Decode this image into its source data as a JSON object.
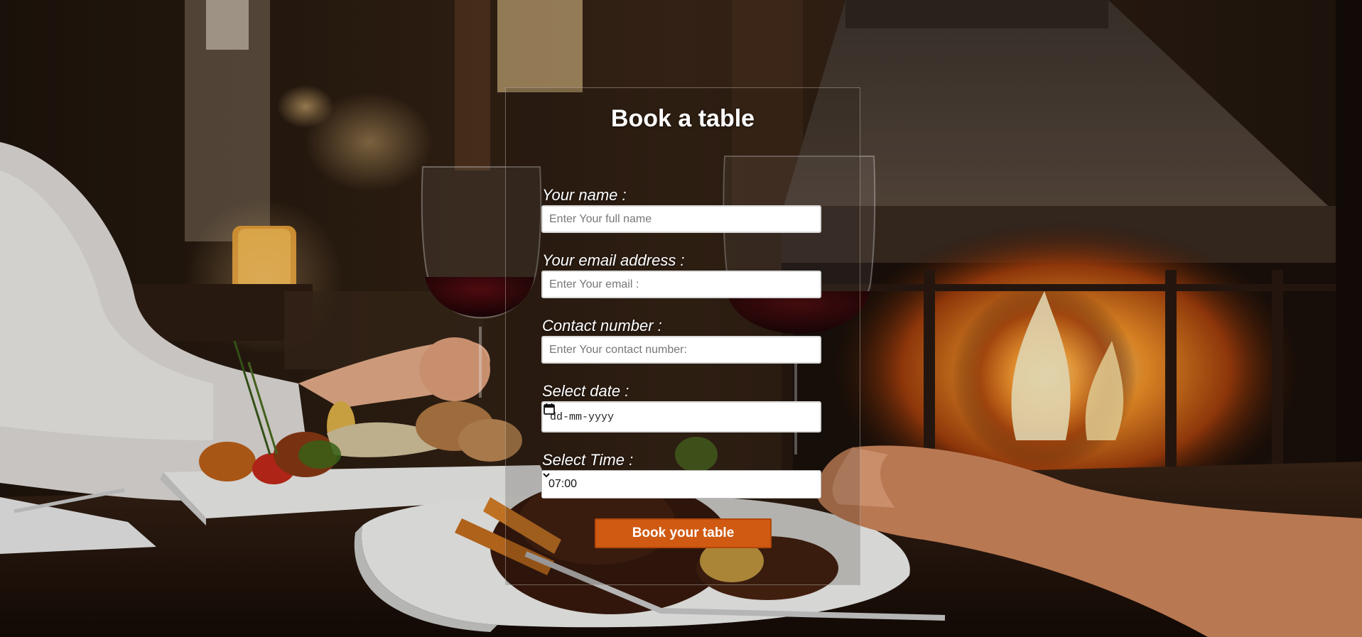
{
  "form": {
    "title": "Book a table",
    "name_label": "Your name :",
    "name_placeholder": "Enter Your full name",
    "email_label": "Your email address :",
    "email_placeholder": "Enter Your email :",
    "contact_label": "Contact number :",
    "contact_placeholder": "Enter Your contact number:",
    "date_label": "Select date :",
    "date_value": "dd-mm-yyyy",
    "time_label": "Select Time :",
    "time_value": "07:00",
    "submit_label": "Book your table"
  },
  "colors": {
    "button": "#d05a12",
    "text": "#ffffff"
  }
}
